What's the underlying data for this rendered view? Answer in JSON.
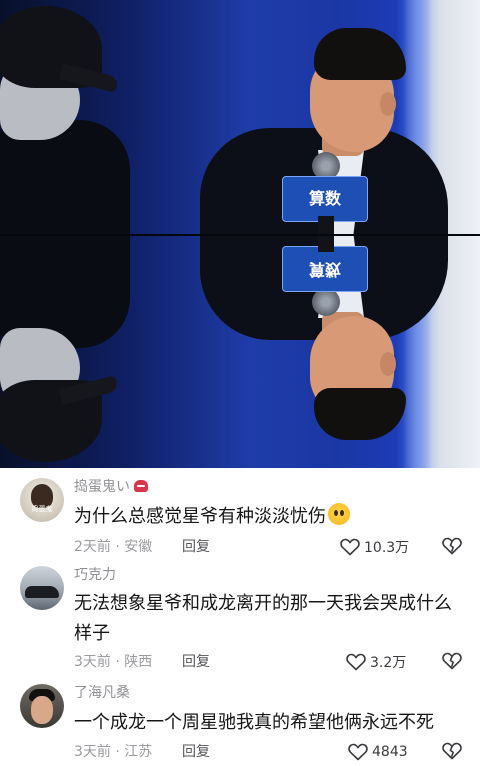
{
  "video": {
    "mic_flag_text": "算数",
    "frames": 2
  },
  "comments": [
    {
      "username": "捣蛋鬼い",
      "has_badge": true,
      "text": "为什么总感觉星爷有种淡淡忧伤",
      "trailing_emoji": "pleading-face",
      "time": "2天前",
      "location": "安徽",
      "reply_label": "回复",
      "likes": "10.3万",
      "avatar": {
        "kind": "cartoon",
        "caption": "捣蛋鬼"
      }
    },
    {
      "username": "巧克力",
      "has_badge": false,
      "text": "无法想象星爷和成龙离开的那一天我会哭成什么样子",
      "time": "3天前",
      "location": "陕西",
      "reply_label": "回复",
      "likes": "3.2万",
      "avatar": {
        "kind": "car"
      }
    },
    {
      "username": "了海凡桑",
      "has_badge": false,
      "text": "一个成龙一个周星驰我真的希望他俩永远不死",
      "time": "3天前",
      "location": "江苏",
      "reply_label": "回复",
      "likes": "4843",
      "avatar": {
        "kind": "portrait"
      }
    }
  ],
  "colors": {
    "username": "#8f8f94",
    "meta": "#9a9a9f",
    "comment_text": "#161616",
    "badge": "#d8344c"
  }
}
